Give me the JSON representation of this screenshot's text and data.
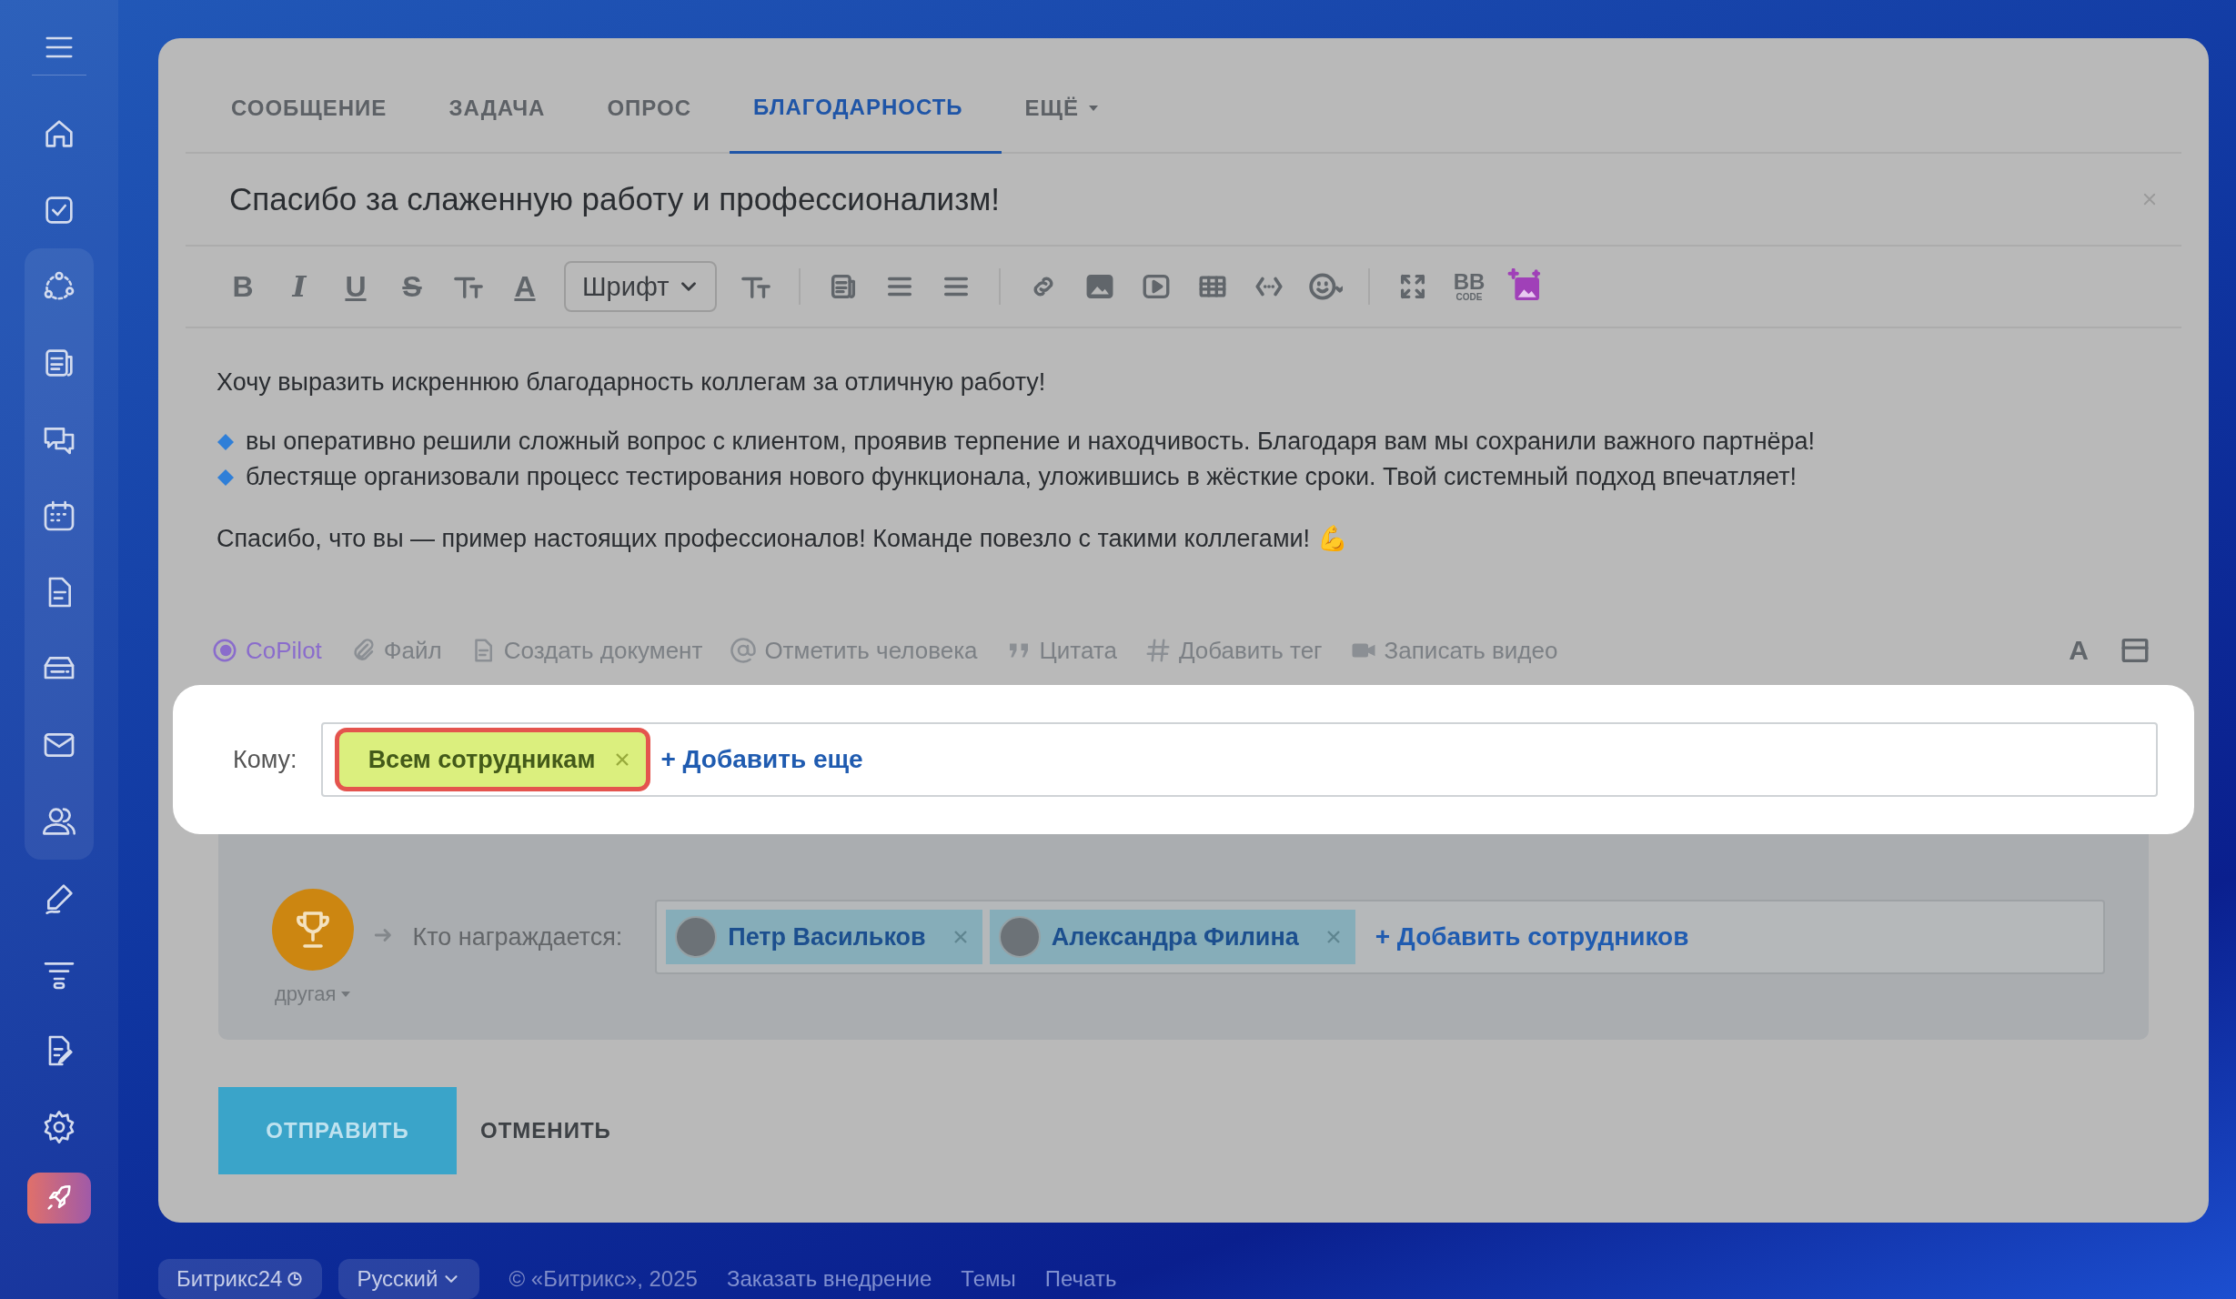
{
  "tabs": [
    {
      "label": "СООБЩЕНИЕ",
      "selected": false,
      "kind": "plain"
    },
    {
      "label": "ЗАДАЧА",
      "selected": false,
      "kind": "plain"
    },
    {
      "label": "ОПРОС",
      "selected": false,
      "kind": "plain"
    },
    {
      "label": "БЛАГОДАРНОСТЬ",
      "selected": true,
      "kind": "plain"
    },
    {
      "label": "ЕЩЁ",
      "selected": false,
      "kind": "menu"
    }
  ],
  "title": "Спасибо за слаженную работу и профессионализм!",
  "toolbar": {
    "format_buttons": [
      {
        "kind": "bold",
        "label": "B"
      },
      {
        "kind": "italic",
        "label": "I"
      },
      {
        "kind": "underline",
        "label": "U"
      },
      {
        "kind": "strike",
        "label": "S"
      },
      {
        "kind": "color",
        "label": "A"
      }
    ],
    "font_select": "Шрифт",
    "bb_label": "BB",
    "bb_sublabel": "CODE",
    "text_format_button": "A"
  },
  "body": [
    {
      "kind": "text",
      "text": "Хочу выразить искреннюю благодарность коллегам за отличную работу!"
    },
    {
      "kind": "bullet",
      "text": "вы оперативно решили сложный вопрос с клиентом, проявив терпение и находчивость. Благодаря вам мы сохранили важного партнёра!"
    },
    {
      "kind": "bullet",
      "text": "блестяще организовали процесс тестирования нового функционала, уложившись в жёсткие сроки. Твой системный подход впечатляет!"
    },
    {
      "kind": "text",
      "text": "Спасибо, что вы — пример настоящих профессионалов! Команде повезло с такими коллегами! 💪"
    }
  ],
  "attachments": [
    {
      "kind": "copilot",
      "label": "CoPilot"
    },
    {
      "kind": "file",
      "label": "Файл"
    },
    {
      "kind": "document",
      "label": "Создать документ"
    },
    {
      "kind": "mention",
      "label": "Отметить человека"
    },
    {
      "kind": "quote",
      "label": "Цитата"
    },
    {
      "kind": "tag",
      "label": "Добавить тег"
    },
    {
      "kind": "video",
      "label": "Записать видео"
    }
  ],
  "recipients": {
    "label": "Кому:",
    "tags": [
      {
        "label": "Всем сотрудникам",
        "highlighted": true
      }
    ],
    "add_link": "+ Добавить еще"
  },
  "award": {
    "badge_label": "другая",
    "label": "Кто награждается:",
    "people": [
      {
        "name": "Петр Васильков"
      },
      {
        "name": "Александра Филина"
      }
    ],
    "add_link": "+ Добавить сотрудников"
  },
  "buttons": {
    "submit": "ОТПРАВИТЬ",
    "cancel": "ОТМЕНИТЬ"
  },
  "footer": [
    {
      "kind": "pill",
      "label": "Битрикс24"
    },
    {
      "kind": "select",
      "label": "Русский"
    },
    {
      "kind": "text",
      "label": "© «Битрикс», 2025"
    },
    {
      "kind": "link",
      "label": "Заказать внедрение"
    },
    {
      "kind": "link",
      "label": "Темы"
    },
    {
      "kind": "link",
      "label": "Печать"
    }
  ]
}
